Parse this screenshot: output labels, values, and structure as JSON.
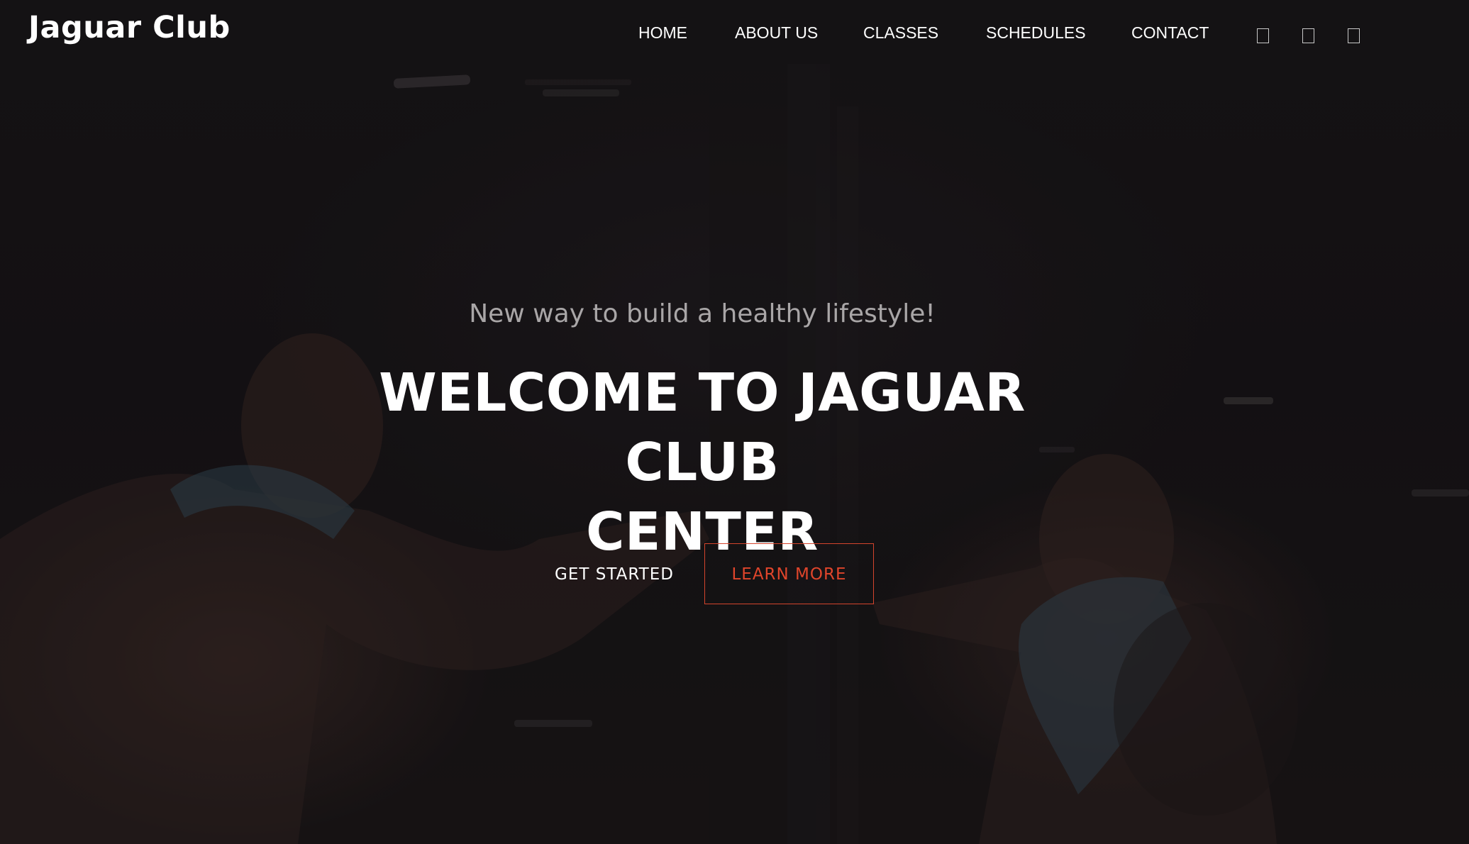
{
  "header": {
    "logo": "Jaguar Club",
    "nav": [
      {
        "label": "HOME"
      },
      {
        "label": "ABOUT US"
      },
      {
        "label": "CLASSES"
      },
      {
        "label": "SCHEDULES"
      },
      {
        "label": "CONTACT"
      }
    ],
    "social_icons": [
      "social-icon-1",
      "social-icon-2",
      "social-icon-3"
    ]
  },
  "hero": {
    "tagline": "New way to build a healthy lifestyle!",
    "headline_line1": "WELCOME TO JAGUAR CLUB",
    "headline_line2": "CENTER",
    "primary_button": "GET STARTED",
    "secondary_button": "LEARN MORE"
  },
  "colors": {
    "accent": "#e0452b",
    "background": "#141214",
    "text": "#ffffff",
    "tagline": "#a9a6a7"
  }
}
